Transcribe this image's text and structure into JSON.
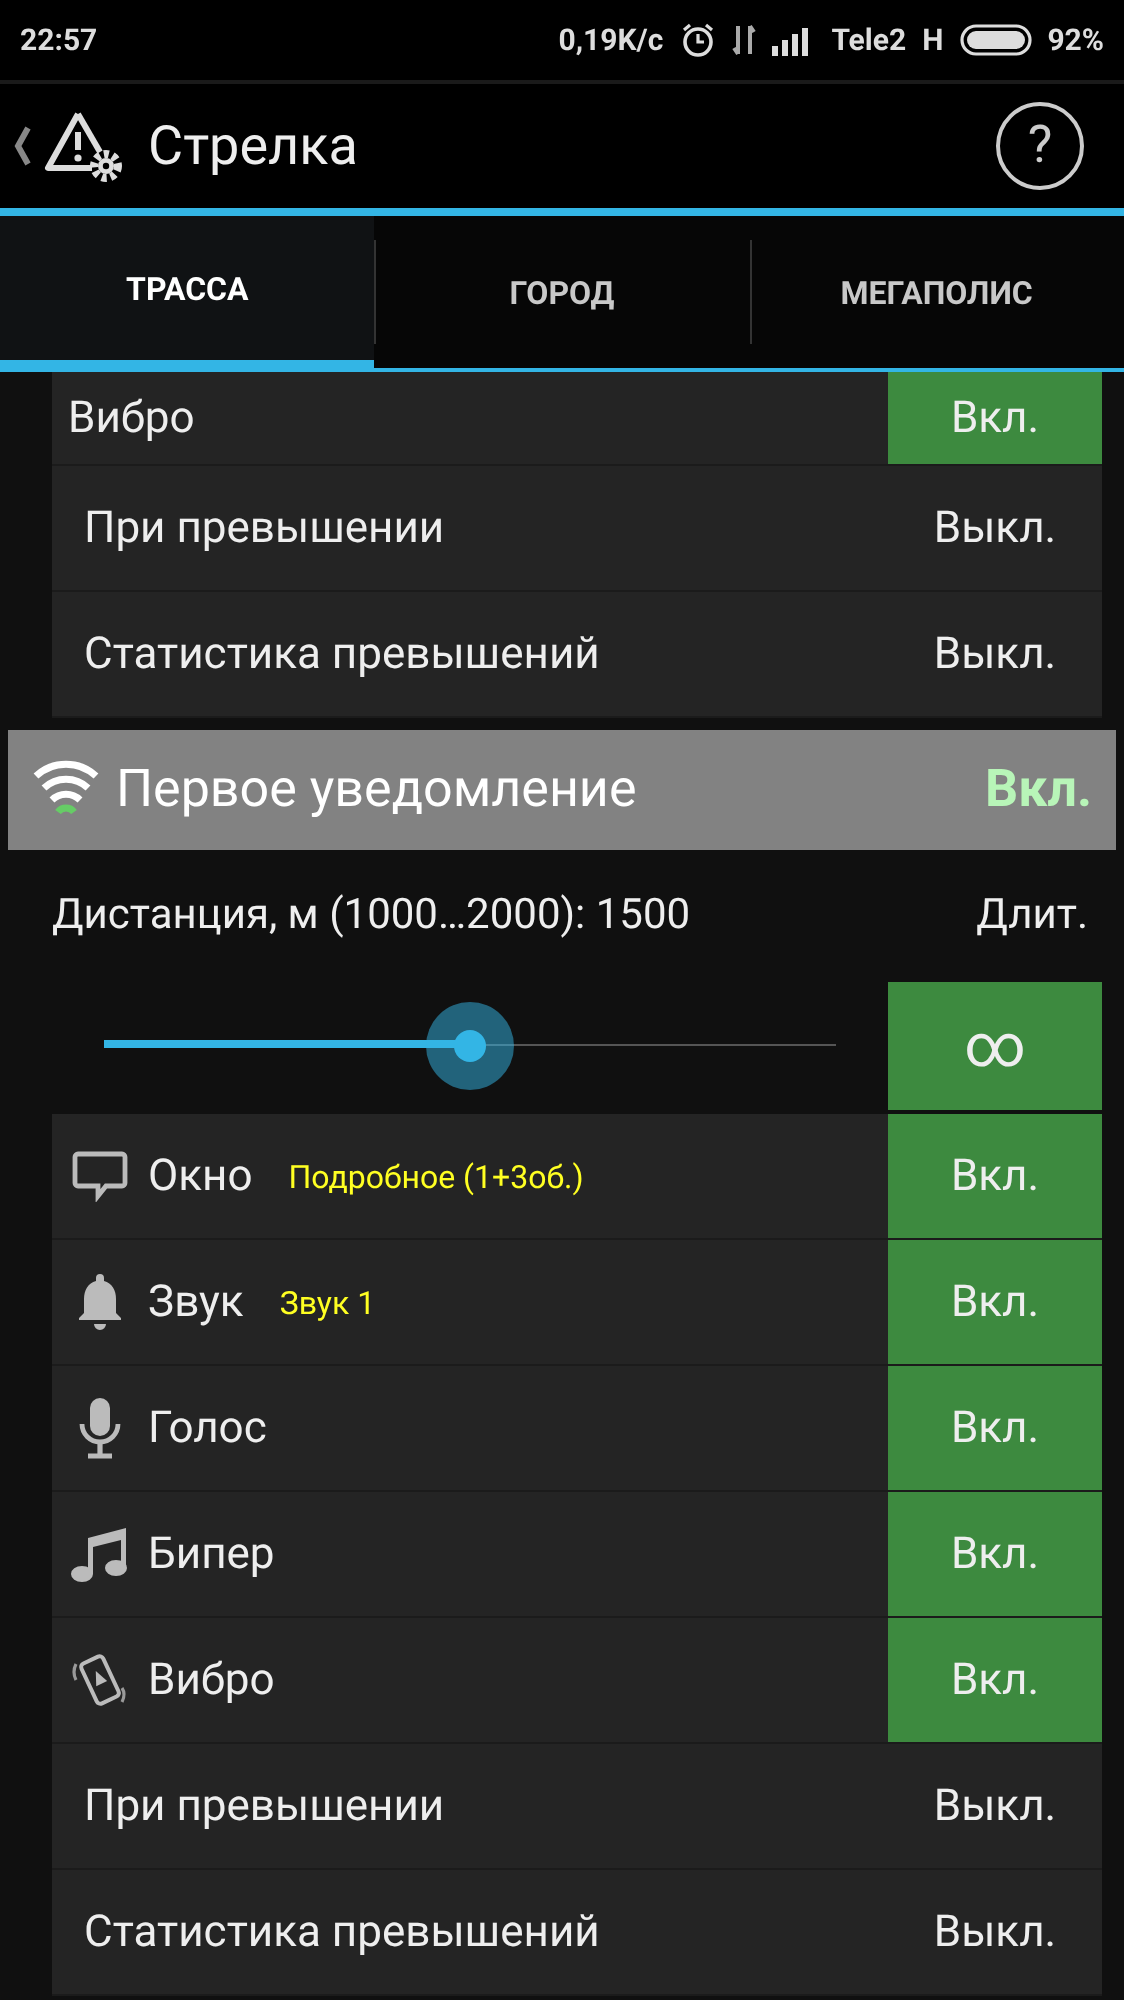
{
  "status_bar": {
    "time": "22:57",
    "speed": "0,19K/с",
    "carrier": "Tele2",
    "network": "H",
    "battery": "92%"
  },
  "app_bar": {
    "title": "Стрелка",
    "help": "?"
  },
  "tabs": [
    {
      "label": "ТРАССА",
      "selected": true
    },
    {
      "label": "ГОРОД",
      "selected": false
    },
    {
      "label": "МЕГАПОЛИС",
      "selected": false
    }
  ],
  "top_rows": [
    {
      "kind": "toggle",
      "label": "Вибро",
      "value": "Вкл.",
      "on": true
    },
    {
      "kind": "plain",
      "label": "При превышении",
      "value": "Выкл.",
      "on": false
    },
    {
      "kind": "plain",
      "label": "Статистика превышений",
      "value": "Выкл.",
      "on": false
    }
  ],
  "section": {
    "title": "Первое уведомление",
    "value": "Вкл.",
    "distance_label": "Дистанция, м (1000…2000): 1500",
    "duration_label": "Длит.",
    "slider": {
      "level": 0.5
    },
    "duration_value": "∞"
  },
  "rows": [
    {
      "kind": "toggle",
      "label": "Окно",
      "detail": "Подробное (1+3об.)",
      "value": "Вкл.",
      "on": true
    },
    {
      "kind": "toggle",
      "label": "Звук",
      "detail": "Звук 1",
      "value": "Вкл.",
      "on": true
    },
    {
      "kind": "toggle",
      "label": "Голос",
      "value": "Вкл.",
      "on": true
    },
    {
      "kind": "toggle",
      "label": "Бипер",
      "value": "Вкл.",
      "on": true
    },
    {
      "kind": "toggle",
      "label": "Вибро",
      "value": "Вкл.",
      "on": true
    },
    {
      "kind": "plain",
      "label": "При превышении",
      "value": "Выкл.",
      "on": false
    },
    {
      "kind": "plain",
      "label": "Статистика превышений",
      "value": "Выкл.",
      "on": false
    }
  ]
}
